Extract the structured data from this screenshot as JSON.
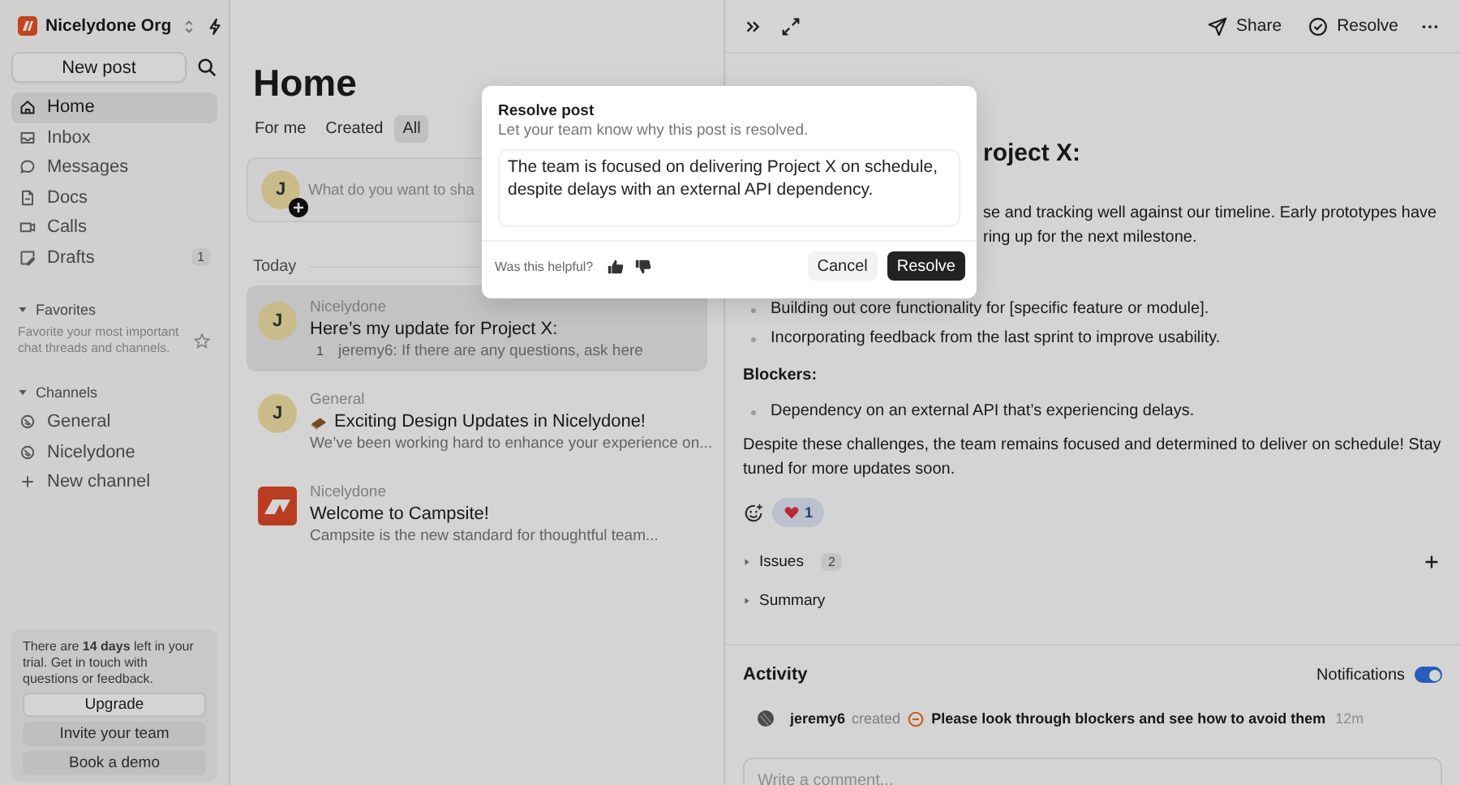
{
  "sidebar": {
    "org_name": "Nicelydone Org",
    "new_post": "New post",
    "nav": [
      {
        "label": "Home",
        "selected": true
      },
      {
        "label": "Inbox",
        "selected": false
      },
      {
        "label": "Messages",
        "selected": false
      },
      {
        "label": "Docs",
        "selected": false
      },
      {
        "label": "Calls",
        "selected": false
      },
      {
        "label": "Drafts",
        "selected": false,
        "badge": "1"
      }
    ],
    "favorites": {
      "heading": "Favorites",
      "expanded": true,
      "hint": "Favorite your most important chat threads and channels."
    },
    "channels": {
      "heading": "Channels",
      "expanded": true,
      "items": [
        {
          "label": "General"
        },
        {
          "label": "Nicelydone"
        }
      ],
      "new_channel": "New channel"
    },
    "trial": {
      "text": "There are **14 days** left in your trial. Get in touch with questions or feedback.",
      "buttons": [
        {
          "label": "Upgrade",
          "kind": "primary"
        },
        {
          "label": "Invite your team",
          "kind": "secondary"
        },
        {
          "label": "Book a demo",
          "kind": "secondary"
        }
      ]
    }
  },
  "feed": {
    "title": "Home",
    "tabs": [
      {
        "label": "For me",
        "selected": false
      },
      {
        "label": "Created",
        "selected": false
      },
      {
        "label": "All",
        "selected": true
      }
    ],
    "composer": {
      "avatar": "J",
      "placeholder": "What do you want to sha"
    },
    "group": "Today",
    "posts": [
      {
        "kind": "initial",
        "avatar": "J",
        "channel": "Nicelydone",
        "title": "Here’s my update for Project X:",
        "reply_count": "1",
        "preview": "jeremy6: If there are any questions, ask here",
        "title_icon": false,
        "selected": true
      },
      {
        "kind": "initial",
        "avatar": "J",
        "channel": "General",
        "title": "Exciting Design Updates in Nicelydone!",
        "title_icon": true,
        "preview": "We’ve been working hard to enhance your experience on...",
        "selected": false
      },
      {
        "kind": "logo",
        "channel": "Nicelydone",
        "title": "Welcome to Campsite!",
        "preview": "Campsite is the new standard for thoughtful team...",
        "title_icon": false,
        "selected": false
      }
    ]
  },
  "detail": {
    "toolbar": {
      "share": "Share",
      "resolve": "Resolve"
    },
    "title_fragment": "roject X:",
    "intro_lines": [
      "se and tracking well against our timeline. Early prototypes have",
      "ring up for the next milestone."
    ],
    "progress_bullets": [
      "Building out core functionality for [specific feature or module].",
      "Incorporating feedback from the last sprint to improve usability."
    ],
    "blockers_heading": "Blockers:",
    "blocker_bullets": [
      "Dependency on an external API that’s experiencing delays."
    ],
    "closing": "Despite these challenges, the team remains focused and determined to deliver on schedule! Stay tuned for more updates soon.",
    "reactions": [
      {
        "count": "1",
        "reacted": true
      }
    ],
    "sections": [
      {
        "label": "Issues",
        "count": "2",
        "expanded": false,
        "addable": true
      },
      {
        "label": "Summary",
        "expanded": false,
        "addable": false
      }
    ],
    "activity": {
      "title": "Activity",
      "notifications_label": "Notifications",
      "notifications_on": true,
      "items": [
        {
          "user": "jeremy6",
          "action": "created",
          "text": "Please look through blockers and see how to avoid them",
          "time": "12m"
        }
      ],
      "comment_placeholder": "Write a comment..."
    }
  },
  "modal": {
    "title": "Resolve post",
    "subtitle": "Let your team know why this post is resolved.",
    "value": "The team is focused on delivering Project X on schedule, despite delays with an external API dependency.",
    "helpful_label": "Was this helpful?",
    "cancel": "Cancel",
    "confirm": "Resolve"
  }
}
